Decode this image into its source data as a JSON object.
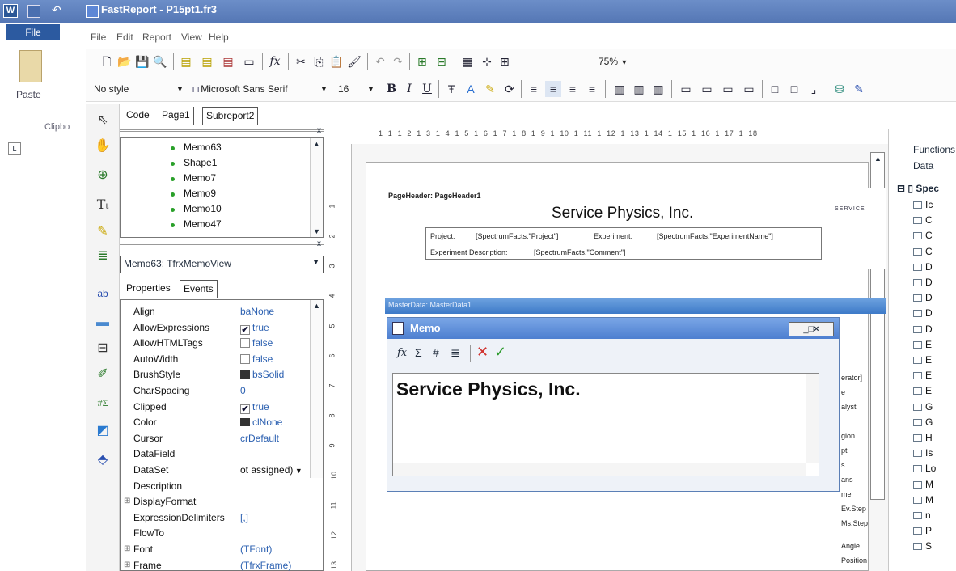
{
  "word": {
    "title": "FastReport - P15pt1.fr3",
    "file_tab": "File",
    "paste_label": "Paste",
    "clipboard_label": "Clipbo"
  },
  "menu": {
    "file": "File",
    "edit": "Edit",
    "report": "Report",
    "view": "View",
    "help": "Help"
  },
  "toolbar": {
    "zoom": "75%",
    "style": "No style",
    "font": "Microsoft Sans Serif",
    "size": "16",
    "bold": "B",
    "italic": "I",
    "underline": "U"
  },
  "tabs": {
    "code": "Code",
    "page1": "Page1",
    "subreport2": "Subreport2"
  },
  "tree": {
    "items": [
      "Memo63",
      "Shape1",
      "Memo7",
      "Memo9",
      "Memo10",
      "Memo47"
    ]
  },
  "object_selector": {
    "value": "Memo63: TfrxMemoView"
  },
  "inspector_tabs": {
    "properties": "Properties",
    "events": "Events"
  },
  "properties": [
    {
      "name": "Align",
      "value": "baNone"
    },
    {
      "name": "AllowExpressions",
      "value": "true",
      "check": "✔"
    },
    {
      "name": "AllowHTMLTags",
      "value": "false",
      "check": ""
    },
    {
      "name": "AutoWidth",
      "value": "false",
      "check": ""
    },
    {
      "name": "BrushStyle",
      "value": "bsSolid",
      "swatch": "#333333"
    },
    {
      "name": "CharSpacing",
      "value": "0"
    },
    {
      "name": "Clipped",
      "value": "true",
      "check": "✔"
    },
    {
      "name": "Color",
      "value": "clNone",
      "swatch": "#333333"
    },
    {
      "name": "Cursor",
      "value": "crDefault"
    },
    {
      "name": "DataField",
      "value": ""
    },
    {
      "name": "DataSet",
      "value": "ot assigned)"
    },
    {
      "name": "Description",
      "value": ""
    },
    {
      "name": "DisplayFormat",
      "value": "",
      "expand": "⊞"
    },
    {
      "name": "ExpressionDelimiters",
      "value": "[,]"
    },
    {
      "name": "FlowTo",
      "value": ""
    },
    {
      "name": "Font",
      "value": "(TFont)",
      "expand": "⊞"
    },
    {
      "name": "Frame",
      "value": "(TfrxFrame)",
      "expand": "⊞"
    }
  ],
  "ruler_top": "1  1  1  2  1  3  1  4  1  5  1  6  1  7  1  8  1  9  1  10  1  11  1  12  1  13  1  14  1  15  1  16  1  17  1  18",
  "ruler_left": [
    "1",
    "2",
    "3",
    "4",
    "5",
    "6",
    "7",
    "8",
    "9",
    "10",
    "11",
    "12",
    "13"
  ],
  "report": {
    "page_header_label": "PageHeader: PageHeader1",
    "company": "Service Physics, Inc.",
    "project_label": "Project:",
    "project_field": "[SpectrumFacts.\"Project\"]",
    "experiment_label": "Experiment:",
    "experiment_field": "[SpectrumFacts.\"ExperimentName\"]",
    "desc_label": "Experiment Description:",
    "desc_field": "[SpectrumFacts.\"Comment\"]",
    "masterdata_label": "MasterData: MasterData1",
    "logo_text": "SERVICE"
  },
  "memo": {
    "title": "Memo",
    "content": "Service Physics, Inc.",
    "behind_labels": [
      "erator]",
      "e",
      "alyst",
      "gion",
      "pt",
      "s",
      "ans",
      "me",
      "Ev.Step",
      "Ms.Step",
      "Angle",
      "Position"
    ]
  },
  "right_panel": {
    "functions": "Functions",
    "data": "Data",
    "root": "Spec",
    "items": [
      "Ic",
      "C",
      "C",
      "C",
      "D",
      "D",
      "D",
      "D",
      "D",
      "E",
      "E",
      "E",
      "E",
      "G",
      "G",
      "H",
      "Is",
      "Lo",
      "M",
      "M",
      "n",
      "P",
      "S"
    ]
  }
}
